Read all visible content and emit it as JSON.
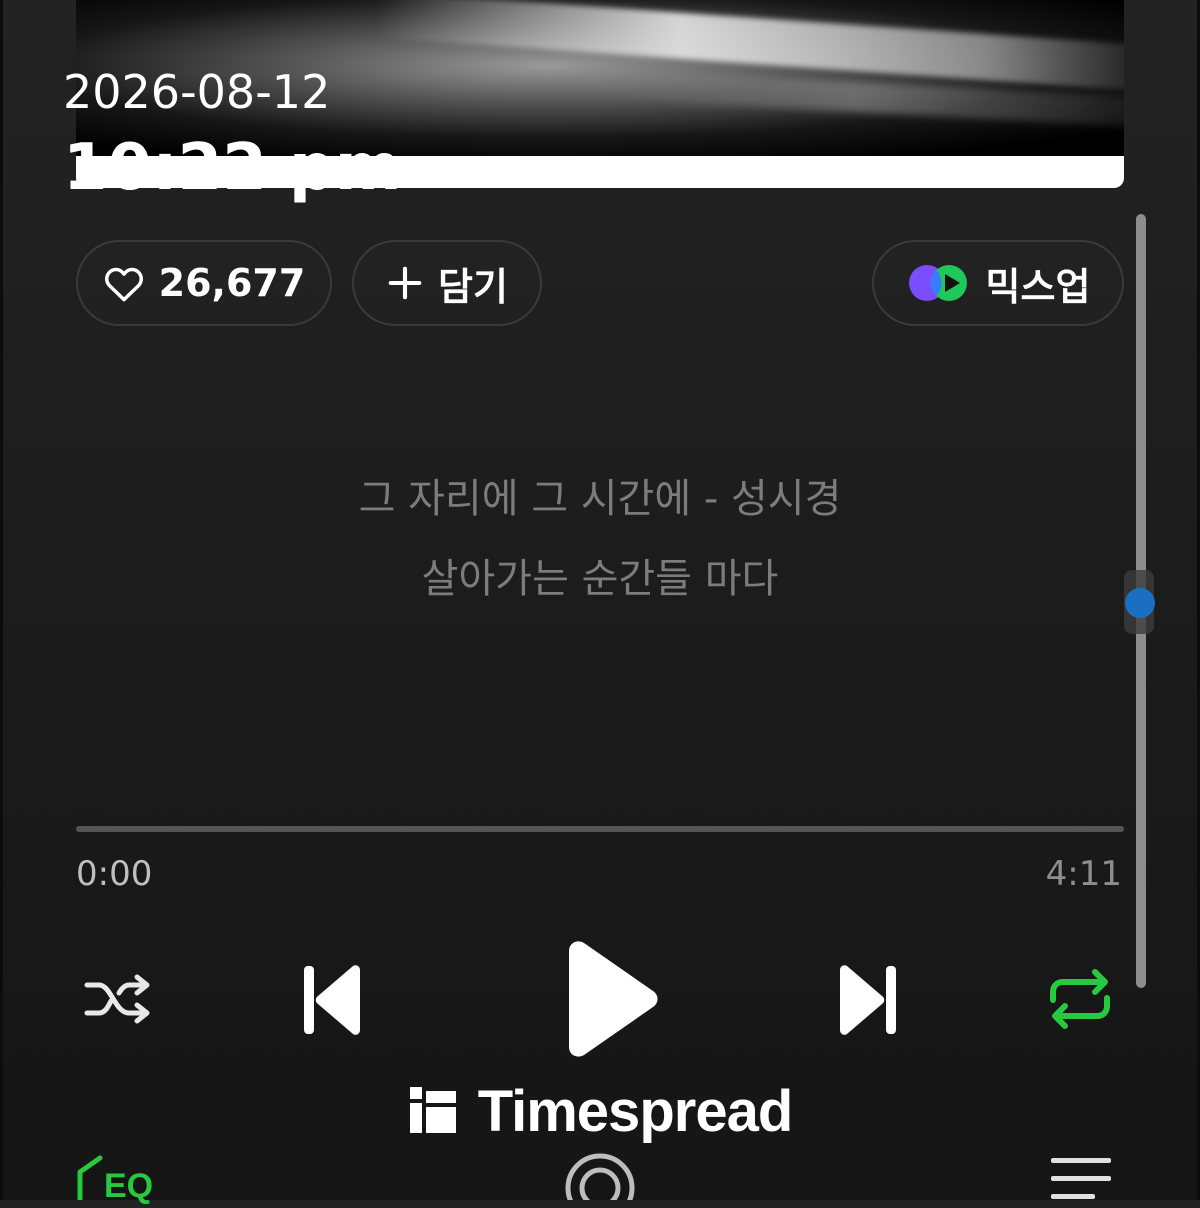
{
  "overlay": {
    "date": "2026-08-12",
    "time": "10:22 pm"
  },
  "actions": {
    "like_count": "26,677",
    "add_label": "담기",
    "mixup_label": "믹스업"
  },
  "lyrics": {
    "line1": "그 자리에 그 시간에 - 성시경",
    "line2": "살아가는 순간들 마다"
  },
  "player": {
    "current_time": "0:00",
    "total_time": "4:11",
    "progress": 0,
    "repeat_active": true,
    "state": "paused"
  },
  "bottom": {
    "eq_label": "EQ"
  },
  "watermark": {
    "text": "Timespread"
  },
  "colors": {
    "accent_green": "#27c93f",
    "scroll_thumb": "#1a6fc4",
    "mixup_purple": "#7b4dff",
    "mixup_blue": "#3a7bff"
  },
  "icons": {
    "like": "heart-outline-icon",
    "add": "plus-icon",
    "mixup": "mixup-logo-icon",
    "shuffle": "shuffle-icon",
    "previous": "skip-previous-icon",
    "play": "play-icon",
    "next": "skip-next-icon",
    "repeat": "repeat-icon",
    "eq": "equalizer-icon",
    "center": "lyrics-mic-icon",
    "playlist": "playlist-icon",
    "watermark_logo": "timespread-logo-icon"
  }
}
